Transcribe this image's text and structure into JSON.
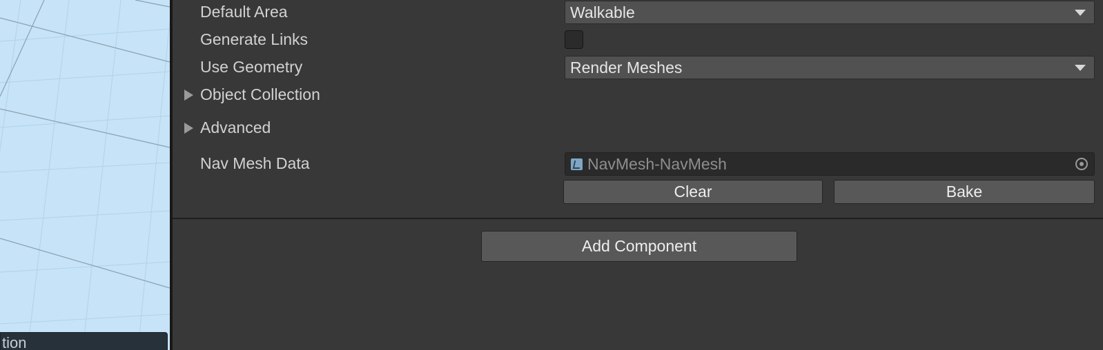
{
  "scene_view": {
    "bottom_label": "tion"
  },
  "inspector": {
    "default_area": {
      "label": "Default Area",
      "value": "Walkable"
    },
    "generate_links": {
      "label": "Generate Links",
      "checked": false
    },
    "use_geometry": {
      "label": "Use Geometry",
      "value": "Render Meshes"
    },
    "object_collection": {
      "label": "Object Collection",
      "expanded": false
    },
    "advanced": {
      "label": "Advanced",
      "expanded": false
    },
    "nav_mesh_data": {
      "label": "Nav Mesh Data",
      "value": "NavMesh-NavMesh"
    },
    "clear_button": "Clear",
    "bake_button": "Bake",
    "add_component_button": "Add Component"
  },
  "colors": {
    "inspector_bg": "#383838",
    "scene_bg": "#c6e3f7",
    "field_bg": "#515151",
    "object_field_bg": "#2a2a2a",
    "button_bg": "#585858"
  }
}
